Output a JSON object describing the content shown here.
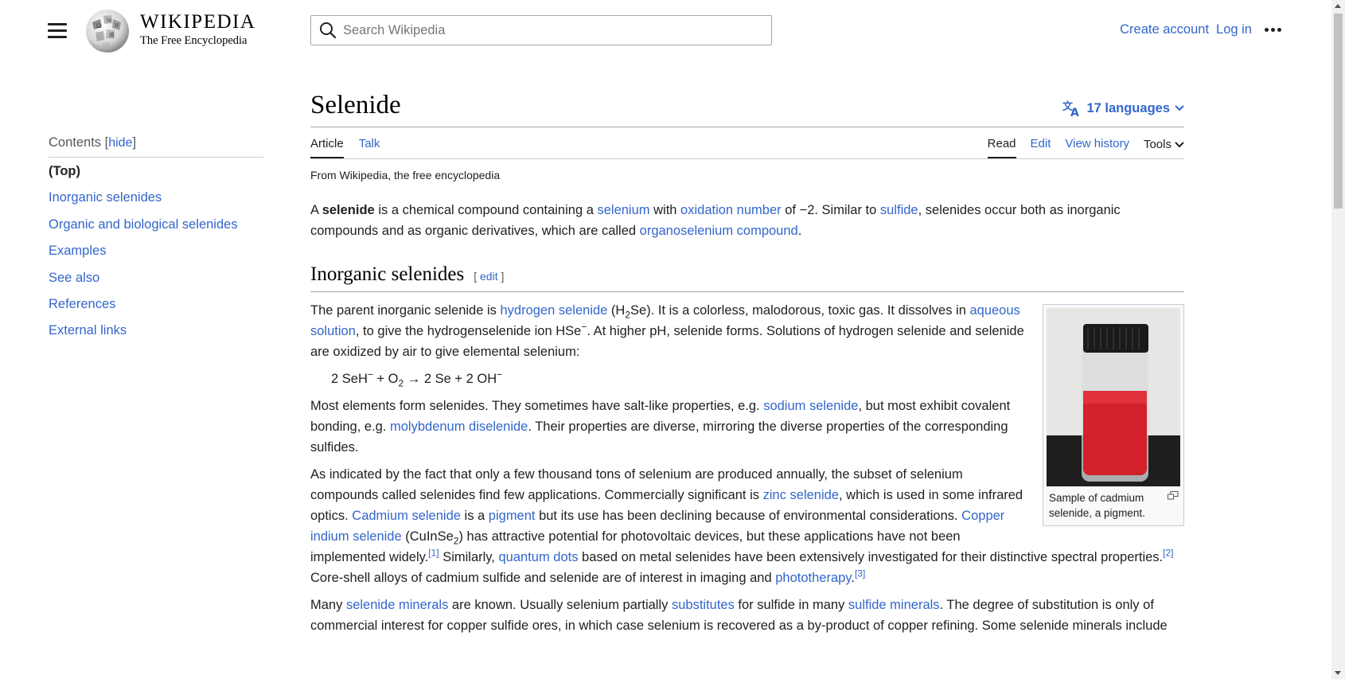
{
  "header": {
    "logo_name": "WIKIPEDIA",
    "tagline": "The Free Encyclopedia",
    "search_placeholder": "Search Wikipedia",
    "create_account": "Create account",
    "log_in": "Log in"
  },
  "toc": {
    "title": "Contents",
    "hide": "hide",
    "items": [
      {
        "label": "(Top)"
      },
      {
        "label": "Inorganic selenides"
      },
      {
        "label": "Organic and biological selenides"
      },
      {
        "label": "Examples"
      },
      {
        "label": "See also"
      },
      {
        "label": "References"
      },
      {
        "label": "External links"
      }
    ]
  },
  "article": {
    "title": "Selenide",
    "languages": "17 languages",
    "tabs_left": [
      "Article",
      "Talk"
    ],
    "tabs_right": [
      "Read",
      "Edit",
      "View history",
      "Tools"
    ],
    "from_line": "From Wikipedia, the free encyclopedia",
    "intro": {
      "t1": "A ",
      "bold": "selenide",
      "t2": " is a chemical compound containing a ",
      "l1": "selenium",
      "t3": " with ",
      "l2": "oxidation number",
      "t4": " of −2. Similar to ",
      "l3": "sulfide",
      "t5": ", selenides occur both as inorganic compounds and as organic derivatives, which are called ",
      "l4": "organoselenium compound",
      "t6": "."
    },
    "section1": {
      "heading": "Inorganic selenides",
      "edit": "edit",
      "p1": {
        "t1": "The parent inorganic selenide is ",
        "l1": "hydrogen selenide",
        "t2": " (H",
        "sub1": "2",
        "t3": "Se). It is a colorless, malodorous, toxic gas. It dissolves in ",
        "l2": "aqueous solution",
        "t4": ", to give the hydrogenselenide ion HSe",
        "sup1": "−",
        "t5": ". At higher pH, selenide forms. Solutions of hydrogen selenide and selenide are oxidized by air to give elemental selenium:"
      },
      "formula": {
        "a": "2 SeH",
        "sup1": "−",
        "b": " + O",
        "sub1": "2",
        "c": " → 2 Se + 2 OH",
        "sup2": "−"
      },
      "p2": {
        "t1": "Most elements form selenides. They sometimes have salt-like properties, e.g. ",
        "l1": "sodium selenide",
        "t2": ", but most exhibit covalent bonding, e.g. ",
        "l2": "molybdenum diselenide",
        "t3": ". Their properties are diverse, mirroring the diverse properties of the corresponding sulfides."
      },
      "p3": {
        "t1": "As indicated by the fact that only a few thousand tons of selenium are produced annually, the subset of selenium compounds called selenides find few applications. Commercially significant is ",
        "l1": "zinc selenide",
        "t2": ", which is used in some infrared optics. ",
        "l2": "Cadmium selenide",
        "t3": " is a ",
        "l3": "pigment",
        "t4": " but its use has been declining because of environmental considerations. ",
        "l4": "Copper indium selenide",
        "t5": " (CuInSe",
        "sub1": "2",
        "t6": ") has attractive potential for photovoltaic devices, but these applications have not been implemented widely.",
        "ref1": "[1]",
        "t7": " Similarly, ",
        "l5": "quantum dots",
        "t8": " based on metal selenides have been extensively investigated for their distinctive spectral properties.",
        "ref2": "[2]",
        "t9": " Core-shell alloys of cadmium sulfide and selenide are of interest in imaging and ",
        "l6": "phototherapy",
        "t10": ".",
        "ref3": "[3]"
      },
      "p4": {
        "t1": "Many ",
        "l1": "selenide minerals",
        "t2": " are known. Usually selenium partially ",
        "l2": "substitutes",
        "t3": " for sulfide in many ",
        "l3": "sulfide minerals",
        "t4": ". The degree of substitution is only of commercial interest for copper sulfide ores, in which case selenium is recovered as a by-product of copper refining. Some selenide minerals include"
      },
      "figure": {
        "caption": "Sample of cadmium selenide, a pigment."
      }
    }
  },
  "colors": {
    "link": "#3366cc",
    "text": "#202122",
    "pigment_red": "#d2202c"
  }
}
